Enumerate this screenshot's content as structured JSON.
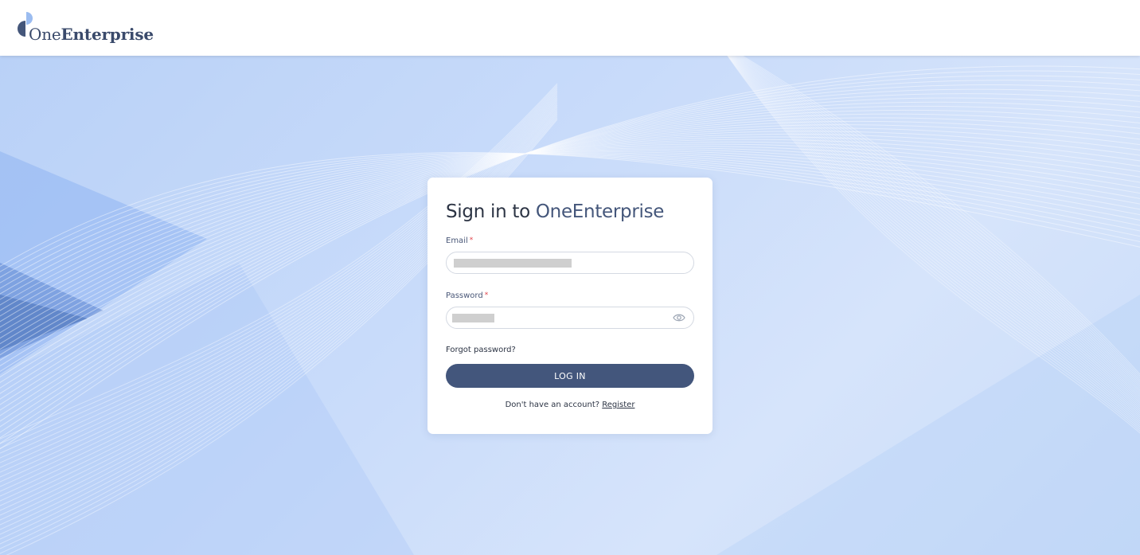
{
  "header": {
    "logo": {
      "text_light": "One",
      "text_bold": "Enterprise",
      "mark_color": "#44567a"
    }
  },
  "login": {
    "title_prefix": "Sign in to",
    "title_brand": "OneEnterprise",
    "email": {
      "label": "Email",
      "required_mark": "*",
      "value": ""
    },
    "password": {
      "label": "Password",
      "required_mark": "*",
      "value": "",
      "toggle_icon": "eye-icon"
    },
    "forgot_label": "Forgot password?",
    "login_label": "LOG IN",
    "register_prompt": "Don't have an account?",
    "register_label": "Register"
  },
  "colors": {
    "primary": "#43567c",
    "required": "#e0434a",
    "background_blue": "#c8dbfa"
  }
}
